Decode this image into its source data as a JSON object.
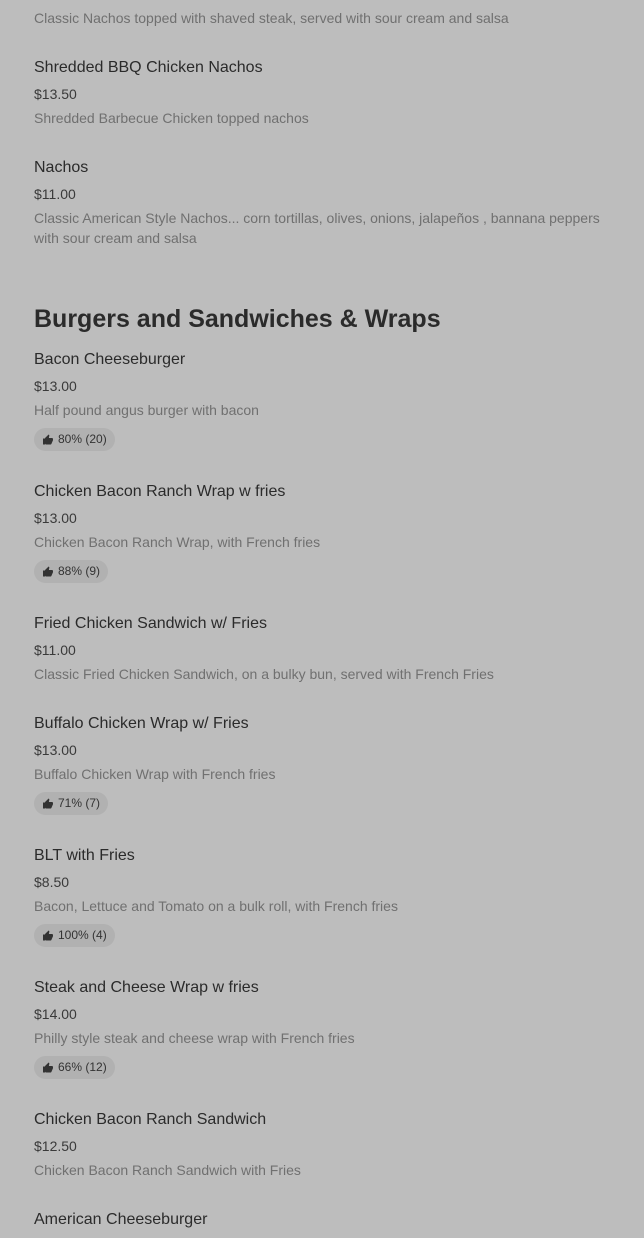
{
  "top_fragment": {
    "desc": "Classic Nachos topped with shaved steak, served with sour cream and salsa"
  },
  "nachos_items": [
    {
      "name": "Shredded BBQ Chicken Nachos",
      "price": "$13.50",
      "desc": "Shredded Barbecue Chicken topped nachos"
    },
    {
      "name": "Nachos",
      "price": "$11.00",
      "desc": "Classic American Style Nachos... corn tortillas, olives, onions, jalapeños , bannana peppers with sour cream and salsa"
    }
  ],
  "section": {
    "title": "Burgers and Sandwiches & Wraps"
  },
  "items": [
    {
      "name": "Bacon Cheeseburger",
      "price": "$13.00",
      "desc": "Half pound angus burger with bacon",
      "rating": "80% (20)"
    },
    {
      "name": "Chicken Bacon Ranch Wrap w fries",
      "price": "$13.00",
      "desc": "Chicken Bacon Ranch Wrap, with French fries",
      "rating": "88% (9)"
    },
    {
      "name": "Fried Chicken Sandwich w/ Fries",
      "price": "$11.00",
      "desc": "Classic Fried Chicken Sandwich, on a bulky bun, served with French Fries"
    },
    {
      "name": "Buffalo Chicken Wrap w/ Fries",
      "price": "$13.00",
      "desc": "Buffalo Chicken Wrap with French fries",
      "rating": "71% (7)"
    },
    {
      "name": "BLT with Fries",
      "price": "$8.50",
      "desc": "Bacon, Lettuce and Tomato on a bulk roll, with French fries",
      "rating": "100% (4)"
    },
    {
      "name": "Steak and Cheese Wrap w fries",
      "price": "$14.00",
      "desc": "Philly style steak and cheese wrap with French fries",
      "rating": "66% (12)"
    },
    {
      "name": "Chicken Bacon Ranch Sandwich",
      "price": "$12.50",
      "desc": "Chicken Bacon Ranch Sandwich with Fries"
    },
    {
      "name": "American Cheeseburger"
    }
  ],
  "icons": {
    "rating": "thumbs-up-icon"
  }
}
